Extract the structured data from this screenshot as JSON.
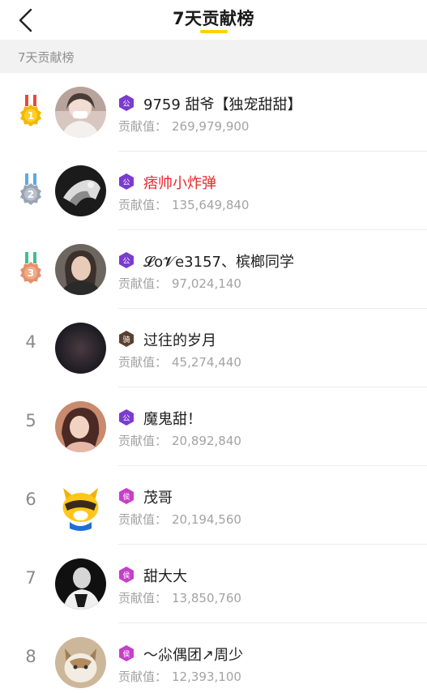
{
  "header": {
    "title": "7天贡献榜",
    "accent_color": "#ffd100"
  },
  "section": {
    "label": "7天贡献榜"
  },
  "contrib_label": "贡献值：",
  "ranking": [
    {
      "rank": "1",
      "medal": "gold",
      "badge": "公",
      "name": "9759 甜爷【独宠甜甜】",
      "value": "269,979,900"
    },
    {
      "rank": "2",
      "medal": "silver",
      "badge": "公",
      "name": "痞帅小炸弹",
      "value": "135,649,840",
      "name_color": "#e8262c"
    },
    {
      "rank": "3",
      "medal": "bronze",
      "badge": "公",
      "name": "𝓛o𝓥e3157、槟榔同学",
      "value": "97,024,140"
    },
    {
      "rank": "4",
      "badge": "骑",
      "name": "过往的岁月",
      "value": "45,274,440"
    },
    {
      "rank": "5",
      "badge": "公",
      "name": "魔鬼甜！",
      "value": "20,892,840"
    },
    {
      "rank": "6",
      "badge": "侯",
      "name": "茂哥",
      "value": "20,194,560"
    },
    {
      "rank": "7",
      "badge": "侯",
      "name": "甜大大",
      "value": "13,850,760"
    },
    {
      "rank": "8",
      "badge": "侯",
      "name": "～尛偶团↗周少",
      "value": "12,393,100"
    }
  ]
}
